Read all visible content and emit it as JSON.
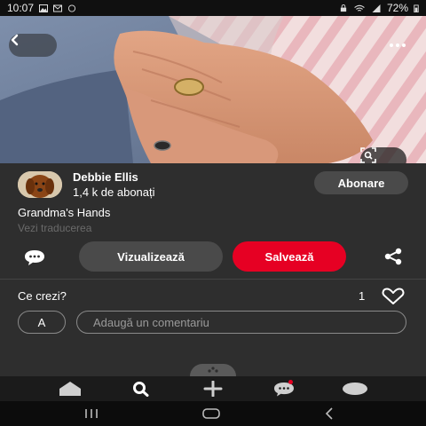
{
  "status_bar": {
    "time": "10:07",
    "battery": "72%"
  },
  "pin": {
    "title": "Grandma's Hands",
    "translate_label": "Vezi traducerea"
  },
  "creator": {
    "name": "Debbie Ellis",
    "followers": "1,4 k de abonați",
    "follow_label": "Abonare"
  },
  "actions": {
    "view_label": "Vizualizează",
    "save_label": "Salvează"
  },
  "comments": {
    "prompt": "Ce crezi?",
    "like_count": "1",
    "user_initial": "A",
    "placeholder": "Adaugă un comentariu"
  },
  "bottom_nav": [
    "home-icon",
    "search-icon",
    "create-icon",
    "messages-icon",
    "profile-icon"
  ],
  "colors": {
    "accent": "#e60023",
    "panel": "#2e2e2e",
    "button": "#4a4a4a"
  }
}
